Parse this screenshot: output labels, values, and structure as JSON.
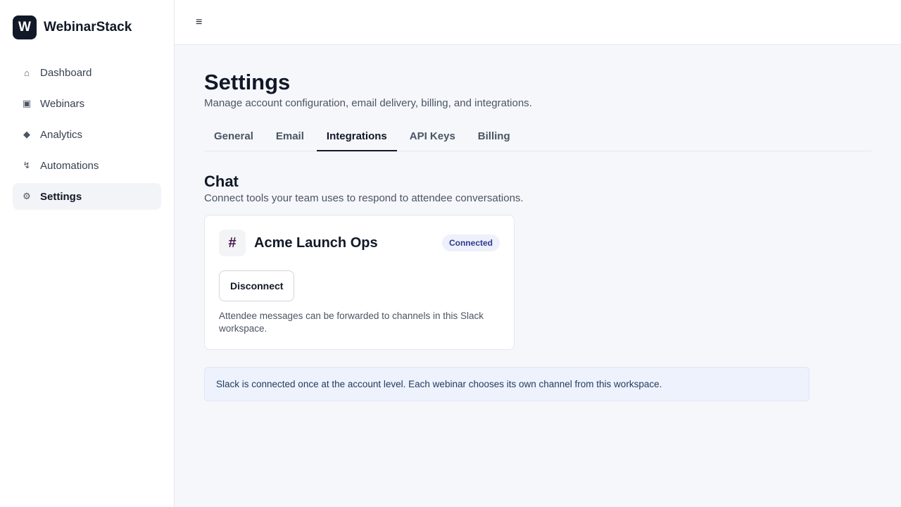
{
  "brand": {
    "logo_letter": "W",
    "name": "WebinarStack"
  },
  "sidebar": {
    "items": [
      {
        "label": "Dashboard",
        "icon": "⌂",
        "icon_name": "home-icon"
      },
      {
        "label": "Webinars",
        "icon": "▣",
        "icon_name": "video-icon"
      },
      {
        "label": "Analytics",
        "icon": "◆",
        "icon_name": "analytics-icon"
      },
      {
        "label": "Automations",
        "icon": "↯",
        "icon_name": "automation-icon"
      },
      {
        "label": "Settings",
        "icon": "⚙",
        "icon_name": "gear-icon",
        "active": true
      }
    ]
  },
  "topbar": {
    "menu_icon": "≡"
  },
  "page": {
    "title": "Settings",
    "subtitle": "Manage account configuration, email delivery, billing, and integrations."
  },
  "tabs": [
    {
      "label": "General"
    },
    {
      "label": "Email"
    },
    {
      "label": "Integrations",
      "active": true
    },
    {
      "label": "API Keys"
    },
    {
      "label": "Billing"
    }
  ],
  "section": {
    "title": "Chat",
    "subtitle": "Connect tools your team uses to respond to attendee conversations."
  },
  "integration_card": {
    "icon": "#",
    "workspace_name": "Acme Launch Ops",
    "status": "Connected",
    "disconnect_label": "Disconnect",
    "note": "Attendee messages can be forwarded to channels in this Slack workspace."
  },
  "info_banner": {
    "text": "Slack is connected once at the account level. Each webinar chooses its own channel from this workspace."
  },
  "colors": {
    "accent": "#111827",
    "badge_bg": "#eef0fb",
    "badge_text": "#2f3a8f",
    "banner_bg": "#eef2fc",
    "slack_icon": "#4a154b"
  }
}
